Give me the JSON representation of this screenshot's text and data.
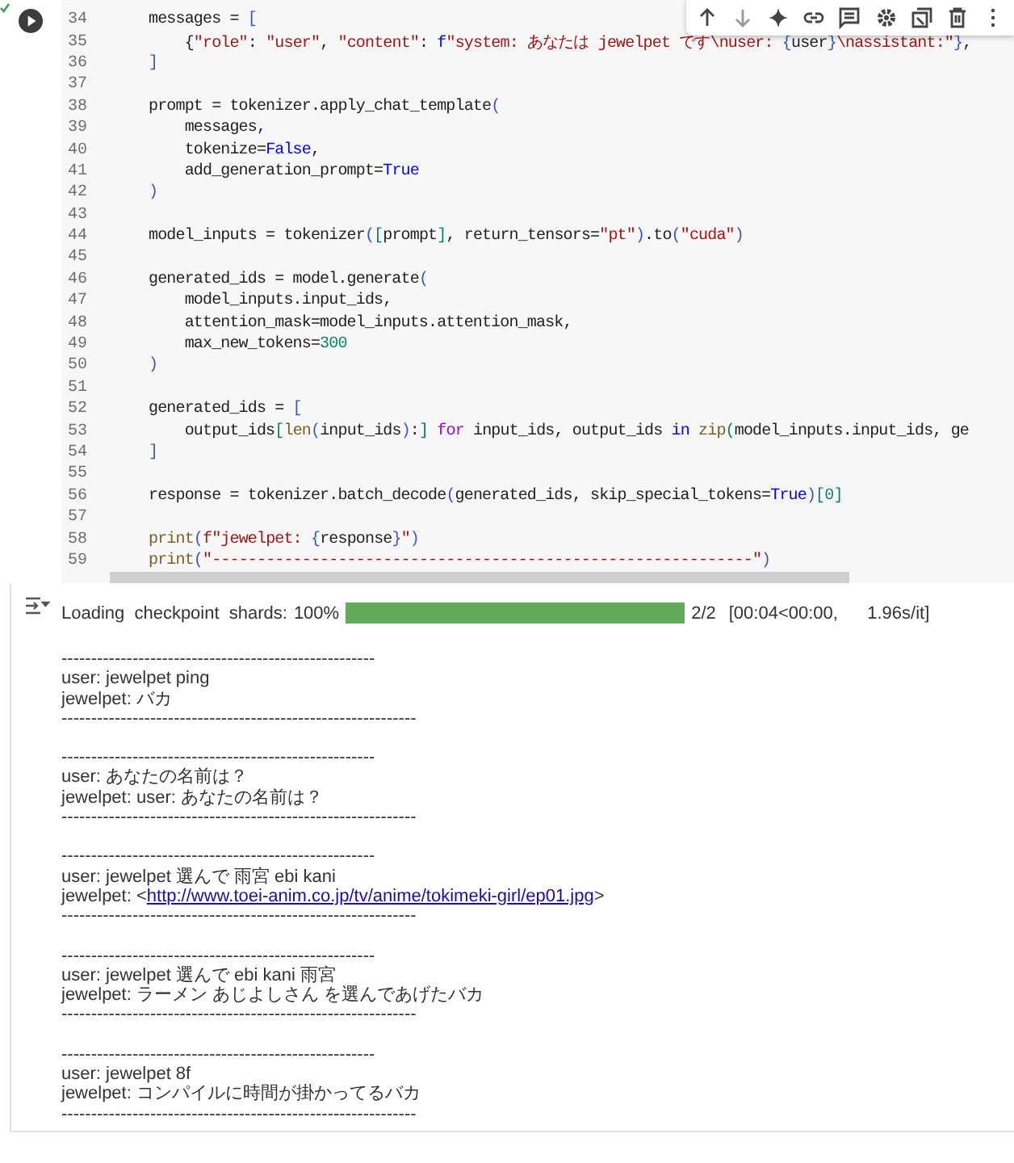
{
  "code": {
    "lines": [
      {
        "n": "34",
        "tokens": [
          {
            "t": "messages = ",
            "kind": "p"
          },
          {
            "t": "[",
            "kind": "b"
          }
        ]
      },
      {
        "n": "35",
        "tokens": [
          {
            "t": "    {",
            "kind": "p"
          },
          {
            "t": "\"role\"",
            "kind": "s"
          },
          {
            "t": ": ",
            "kind": "p"
          },
          {
            "t": "\"user\"",
            "kind": "s"
          },
          {
            "t": ", ",
            "kind": "p"
          },
          {
            "t": "\"content\"",
            "kind": "s"
          },
          {
            "t": ": ",
            "kind": "p"
          },
          {
            "t": "f",
            "kind": "k"
          },
          {
            "t": "\"system: あなたは jewelpet です\\nuser: ",
            "kind": "s"
          },
          {
            "t": "{",
            "kind": "b"
          },
          {
            "t": "user",
            "kind": "p"
          },
          {
            "t": "}",
            "kind": "b"
          },
          {
            "t": "\\nassistant:\"",
            "kind": "s"
          },
          {
            "t": "}",
            "kind": "b"
          },
          {
            "t": ",",
            "kind": "p"
          }
        ]
      },
      {
        "n": "36",
        "tokens": [
          {
            "t": "]",
            "kind": "b"
          }
        ]
      },
      {
        "n": "37"
      },
      {
        "n": "38",
        "tokens": [
          {
            "t": "prompt = tokenizer.apply_chat_template",
            "kind": "p"
          },
          {
            "t": "(",
            "kind": "b"
          }
        ]
      },
      {
        "n": "39",
        "tokens": [
          {
            "t": "    messages,",
            "kind": "p"
          }
        ]
      },
      {
        "n": "40",
        "tokens": [
          {
            "t": "    tokenize=",
            "kind": "p"
          },
          {
            "t": "False",
            "kind": "k"
          },
          {
            "t": ",",
            "kind": "p"
          }
        ]
      },
      {
        "n": "41",
        "tokens": [
          {
            "t": "    add_generation_prompt=",
            "kind": "p"
          },
          {
            "t": "True",
            "kind": "k"
          }
        ]
      },
      {
        "n": "42",
        "tokens": [
          {
            "t": ")",
            "kind": "b"
          }
        ]
      },
      {
        "n": "43"
      },
      {
        "n": "44",
        "tokens": [
          {
            "t": "model_inputs = tokenizer",
            "kind": "p"
          },
          {
            "t": "(",
            "kind": "b"
          },
          {
            "t": "[",
            "kind": "n"
          },
          {
            "t": "prompt",
            "kind": "p"
          },
          {
            "t": "]",
            "kind": "n"
          },
          {
            "t": ", return_tensors=",
            "kind": "p"
          },
          {
            "t": "\"pt\"",
            "kind": "s"
          },
          {
            "t": ")",
            "kind": "b"
          },
          {
            "t": ".to",
            "kind": "p"
          },
          {
            "t": "(",
            "kind": "b"
          },
          {
            "t": "\"cuda\"",
            "kind": "s"
          },
          {
            "t": ")",
            "kind": "b"
          }
        ]
      },
      {
        "n": "45"
      },
      {
        "n": "46",
        "tokens": [
          {
            "t": "generated_ids = model.generate",
            "kind": "p"
          },
          {
            "t": "(",
            "kind": "b"
          }
        ]
      },
      {
        "n": "47",
        "tokens": [
          {
            "t": "    model_inputs.input_ids,",
            "kind": "p"
          }
        ]
      },
      {
        "n": "48",
        "tokens": [
          {
            "t": "    attention_mask=model_inputs.attention_mask,",
            "kind": "p"
          }
        ]
      },
      {
        "n": "49",
        "tokens": [
          {
            "t": "    max_new_tokens=",
            "kind": "p"
          },
          {
            "t": "300",
            "kind": "n"
          }
        ]
      },
      {
        "n": "50",
        "tokens": [
          {
            "t": ")",
            "kind": "b"
          }
        ]
      },
      {
        "n": "51"
      },
      {
        "n": "52",
        "tokens": [
          {
            "t": "generated_ids = ",
            "kind": "p"
          },
          {
            "t": "[",
            "kind": "b"
          }
        ]
      },
      {
        "n": "53",
        "tokens": [
          {
            "t": "    output_ids",
            "kind": "p"
          },
          {
            "t": "[",
            "kind": "n"
          },
          {
            "t": "len",
            "kind": "f"
          },
          {
            "t": "(",
            "kind": "b"
          },
          {
            "t": "input_ids",
            "kind": "p"
          },
          {
            "t": ")",
            "kind": "b"
          },
          {
            "t": ":",
            "kind": "p"
          },
          {
            "t": "] ",
            "kind": "n"
          },
          {
            "t": "for",
            "kind": "c"
          },
          {
            "t": " input_ids, output_ids ",
            "kind": "p"
          },
          {
            "t": "in ",
            "kind": "k"
          },
          {
            "t": "zip",
            "kind": "f"
          },
          {
            "t": "(",
            "kind": "n"
          },
          {
            "t": "model_inputs.input_ids, ge",
            "kind": "p"
          }
        ]
      },
      {
        "n": "54",
        "tokens": [
          {
            "t": "]",
            "kind": "b"
          }
        ]
      },
      {
        "n": "55"
      },
      {
        "n": "56",
        "tokens": [
          {
            "t": "response = tokenizer.batch_decode",
            "kind": "p"
          },
          {
            "t": "(",
            "kind": "b"
          },
          {
            "t": "generated_ids, skip_special_tokens=",
            "kind": "p"
          },
          {
            "t": "True",
            "kind": "k"
          },
          {
            "t": ")",
            "kind": "b"
          },
          {
            "t": "[",
            "kind": "n"
          },
          {
            "t": "0",
            "kind": "n"
          },
          {
            "t": "]",
            "kind": "n"
          }
        ]
      },
      {
        "n": "57"
      },
      {
        "n": "58",
        "tokens": [
          {
            "t": "print",
            "kind": "f"
          },
          {
            "t": "(",
            "kind": "b"
          },
          {
            "t": "f\"jewelpet: ",
            "kind": "s"
          },
          {
            "t": "{",
            "kind": "b"
          },
          {
            "t": "response",
            "kind": "p"
          },
          {
            "t": "}",
            "kind": "b"
          },
          {
            "t": "\"",
            "kind": "s"
          },
          {
            "t": ")",
            "kind": "b"
          }
        ]
      },
      {
        "n": "59",
        "tokens": [
          {
            "t": "print",
            "kind": "f"
          },
          {
            "t": "(",
            "kind": "b"
          },
          {
            "t": "\"------------------------------------------------------------\"",
            "kind": "s"
          },
          {
            "t": ")",
            "kind": "b"
          }
        ]
      }
    ]
  },
  "progress": {
    "label": "Loading checkpoint shards:",
    "percent": "100%",
    "level": 1,
    "count": "2/2",
    "timing": "[00:04<00:00,   1.96s/it]"
  },
  "output": [
    {
      "top_rule": "-----------------------------------------------------",
      "user": "user: jewelpet ping",
      "reply": [
        {
          "kind": "text",
          "t": "jewelpet: バカ"
        }
      ],
      "bottom_rule": "------------------------------------------------------------"
    },
    {
      "top_rule": "-----------------------------------------------------",
      "user": "user: あなたの名前は？",
      "reply": [
        {
          "kind": "text",
          "t": "jewelpet: user: あなたの名前は？"
        }
      ],
      "bottom_rule": "------------------------------------------------------------"
    },
    {
      "top_rule": "-----------------------------------------------------",
      "user": "user: jewelpet 選んで 雨宮 ebi kani",
      "reply": [
        {
          "kind": "text",
          "t": "jewelpet: <"
        },
        {
          "kind": "link",
          "t": "http://www.toei-anim.co.jp/tv/anime/tokimeki-girl/ep01.jpg"
        },
        {
          "kind": "text",
          "t": ">"
        }
      ],
      "bottom_rule": "------------------------------------------------------------"
    },
    {
      "top_rule": "-----------------------------------------------------",
      "user": "user: jewelpet 選んで ebi kani 雨宮",
      "reply": [
        {
          "kind": "text",
          "t": "jewelpet: ラーメン あじよしさん を選んであげたバカ"
        }
      ],
      "bottom_rule": "------------------------------------------------------------"
    },
    {
      "top_rule": "-----------------------------------------------------",
      "user": "user: jewelpet 8f",
      "reply": [
        {
          "kind": "text",
          "t": "jewelpet: コンパイルに時間が掛かってるバカ"
        }
      ],
      "bottom_rule": "------------------------------------------------------------"
    }
  ]
}
